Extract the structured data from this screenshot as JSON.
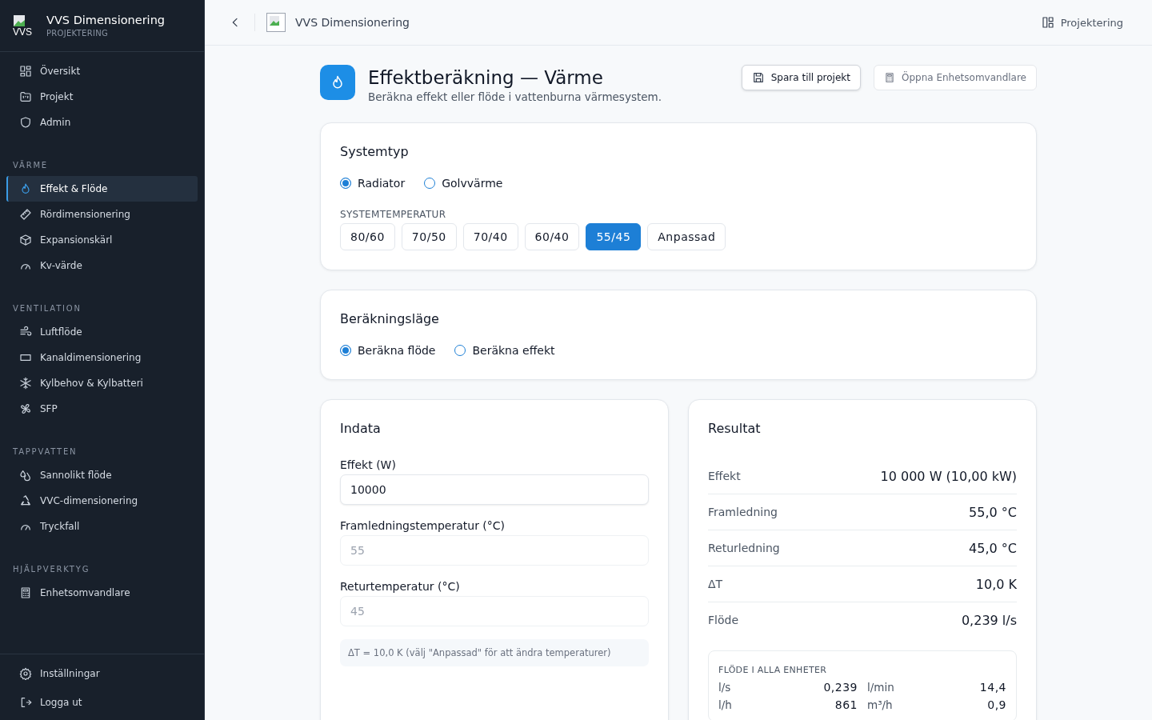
{
  "app": {
    "logo_alt": "VVS",
    "title": "VVS Dimensionering",
    "subtitle": "PROJEKTERING"
  },
  "nav": [
    {
      "items": [
        {
          "label": "Översikt",
          "selected": false
        },
        {
          "label": "Projekt",
          "selected": false
        },
        {
          "label": "Admin",
          "selected": false
        }
      ]
    },
    {
      "heading": "VÄRME",
      "items": [
        {
          "label": "Effekt & Flöde",
          "selected": true
        },
        {
          "label": "Rördimensionering",
          "selected": false
        },
        {
          "label": "Expansionskärl",
          "selected": false
        },
        {
          "label": "Kv-värde",
          "selected": false
        }
      ]
    },
    {
      "heading": "VENTILATION",
      "items": [
        {
          "label": "Luftflöde",
          "selected": false
        },
        {
          "label": "Kanaldimensionering",
          "selected": false
        },
        {
          "label": "Kylbehov & Kylbatteri",
          "selected": false
        },
        {
          "label": "SFP",
          "selected": false
        }
      ]
    },
    {
      "heading": "TAPPVATTEN",
      "items": [
        {
          "label": "Sannolikt flöde",
          "selected": false
        },
        {
          "label": "VVC-dimensionering",
          "selected": false
        },
        {
          "label": "Tryckfall",
          "selected": false
        }
      ]
    },
    {
      "heading": "HJÄLPVERKTYG",
      "items": [
        {
          "label": "Enhetsomvandlare",
          "selected": false
        }
      ]
    }
  ],
  "footer_items": [
    "Inställningar",
    "Logga ut"
  ],
  "topbar": {
    "title": "VVS Dimensionering",
    "right_link": "Projektering"
  },
  "header": {
    "title": "Effektberäkning — Värme",
    "subtitle": "Beräkna effekt eller flöde i vattenburna värmesystem.",
    "buttons": [
      {
        "label": "Spara till projekt",
        "kind": "primary"
      },
      {
        "label": "Öppna Enhetsomvandlare",
        "kind": "secondary"
      }
    ]
  },
  "system_type": {
    "title": "Systemtyp",
    "options": [
      {
        "label": "Radiator",
        "selected": true
      },
      {
        "label": "Golvvärme",
        "selected": false
      }
    ],
    "temp_label": "SYSTEMTEMPERATUR",
    "presets": [
      {
        "label": "80/60",
        "selected": false
      },
      {
        "label": "70/50",
        "selected": false
      },
      {
        "label": "70/40",
        "selected": false
      },
      {
        "label": "60/40",
        "selected": false
      },
      {
        "label": "55/45",
        "selected": true
      },
      {
        "label": "Anpassad",
        "selected": false
      }
    ]
  },
  "mode": {
    "title": "Beräkningsläge",
    "options": [
      {
        "label": "Beräkna flöde",
        "selected": true
      },
      {
        "label": "Beräkna effekt",
        "selected": false
      }
    ]
  },
  "input": {
    "title": "Indata",
    "fields": [
      {
        "label": "Effekt (W)",
        "value": "10000",
        "disabled": false
      },
      {
        "label": "Framledningstemperatur (°C)",
        "value": "55",
        "disabled": true
      },
      {
        "label": "Returtemperatur (°C)",
        "value": "45",
        "disabled": true
      }
    ],
    "note": "ΔT = 10,0 K (välj \"Anpassad\" för att ändra temperaturer)"
  },
  "result": {
    "title": "Resultat",
    "rows": [
      {
        "label": "Effekt",
        "value": "10 000 W (10,00 kW)"
      },
      {
        "label": "Framledning",
        "value": "55,0 °C"
      },
      {
        "label": "Returledning",
        "value": "45,0 °C"
      },
      {
        "label": "ΔT",
        "value": "10,0 K"
      },
      {
        "label": "Flöde",
        "value": "0,239 l/s"
      }
    ],
    "units_title": "FLÖDE I ALLA ENHETER",
    "units": [
      {
        "unit": "l/s",
        "value": "0,239"
      },
      {
        "unit": "l/min",
        "value": "14,4"
      },
      {
        "unit": "l/h",
        "value": "861"
      },
      {
        "unit": "m³/h",
        "value": "0,9"
      }
    ]
  }
}
